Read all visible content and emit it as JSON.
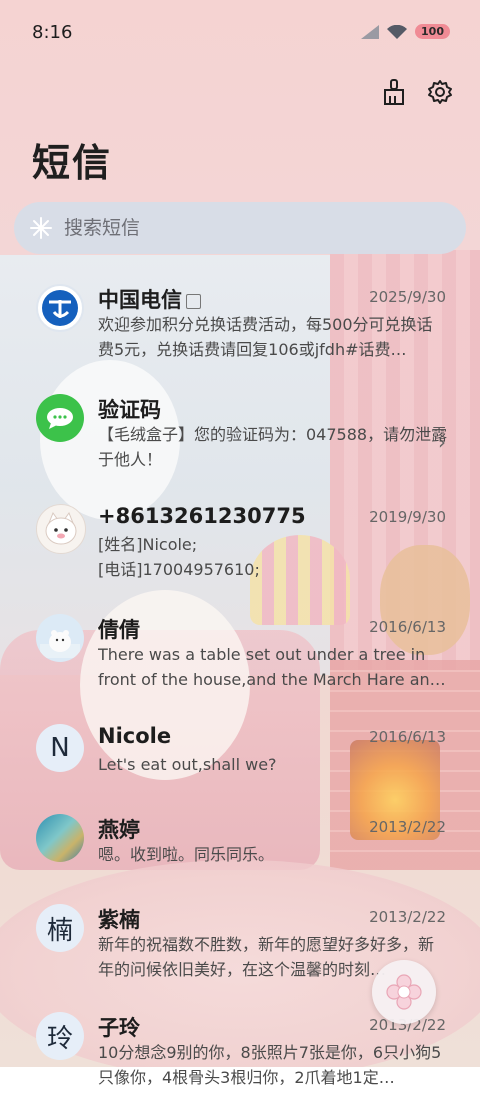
{
  "status_bar": {
    "time": "8:16",
    "battery": "100"
  },
  "header": {
    "title": "短信"
  },
  "search": {
    "placeholder": "搜索短信"
  },
  "conversations": [
    {
      "name": "中国电信",
      "date": "2025/9/30",
      "preview": "欢迎参加积分兑换话费活动，每500分可兑换话费5元，兑换话费请回复106或jfdh#话费…",
      "avatar": "china-telecom-logo"
    },
    {
      "name": "验证码",
      "date": "",
      "preview": "【毛绒盒子】您的验证码为：047588，请勿泄露于他人！",
      "avatar": "message-app-icon"
    },
    {
      "name": "+8613261230775",
      "date": "2019/9/30",
      "preview": "[姓名]Nicole;\n[电话]17004957610;",
      "avatar": "cat-avatar"
    },
    {
      "name": "倩倩",
      "date": "2016/6/13",
      "preview": "There was a table set out under a tree in front of the house,and the March Hare an…",
      "avatar": "polar-bear-avatar"
    },
    {
      "name": "Nicole",
      "date": "2016/6/13",
      "preview": "Let's eat out,shall we?",
      "avatar_letter": "N"
    },
    {
      "name": "燕婷",
      "date": "2013/2/22",
      "preview": "嗯。收到啦。同乐同乐。",
      "avatar": "landscape-avatar"
    },
    {
      "name": "紫楠",
      "date": "2013/2/22",
      "preview": "新年的祝福数不胜数，新年的愿望好多好多，新年的问候依旧美好，在这个温馨的时刻…",
      "avatar_letter": "楠"
    },
    {
      "name": "子玲",
      "date": "2013/2/22",
      "preview": "10分想念9别的你，8张照片7张是你，6只小狗5只像你，4根骨头3根归你，2爪着地1定…",
      "avatar_letter": "玲"
    }
  ],
  "colors": {
    "telecom_blue": "#1560bd",
    "message_green": "#3cc24a",
    "search_bg": "#d6dde8"
  }
}
